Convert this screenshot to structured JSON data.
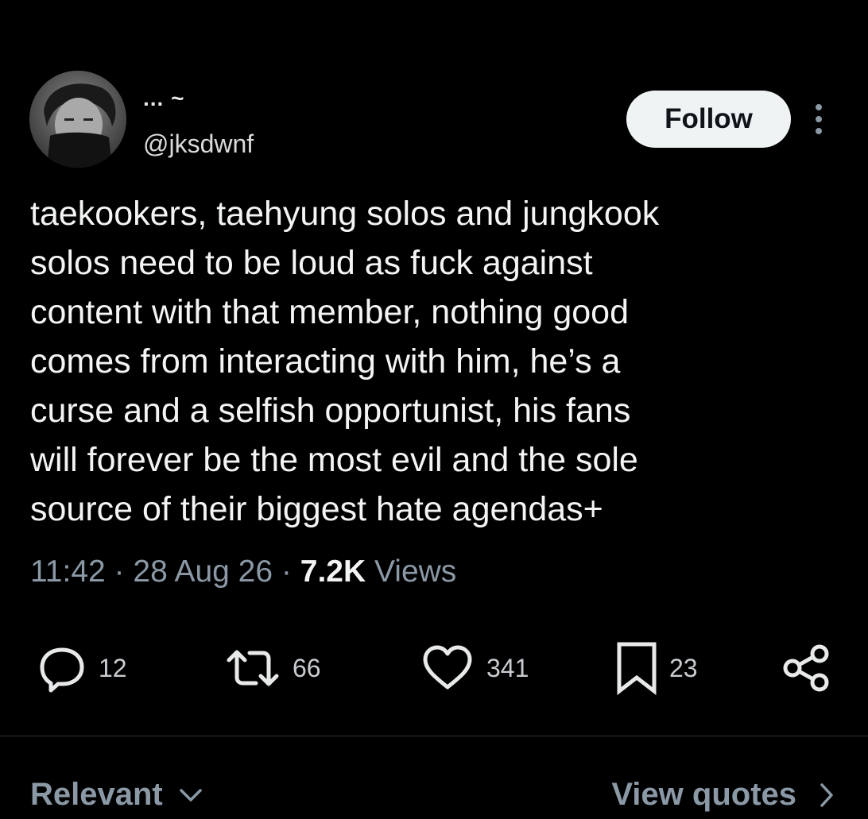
{
  "author": {
    "display_name": "... ~",
    "handle": "@jksdwnf",
    "avatar_icon": "profile-photo"
  },
  "follow_label": "Follow",
  "more_icon": "more-vertical-icon",
  "tweet": {
    "text": "taekookers, taehyung solos and jungkook\nsolos need to be loud as fuck against\ncontent with that member, nothing good\ncomes from interacting with him, he’s a\ncurse and a selfish opportunist, his fans\nwill forever be the most evil and the sole\nsource of their biggest hate agendas+"
  },
  "meta": {
    "time": "11:42",
    "separator": "·",
    "date": "28 Aug 26",
    "views_count": "7.2K",
    "views_label": "Views"
  },
  "actions": {
    "replies": "12",
    "reposts": "66",
    "likes": "341",
    "bookmarks": "23"
  },
  "footer": {
    "sort_label": "Relevant",
    "view_quotes_label": "View quotes"
  },
  "colors": {
    "background": "#000000",
    "text_primary": "#e7e9ea",
    "text_secondary": "#8b98a5",
    "follow_bg": "#eff3f4",
    "divider": "#2f3336"
  }
}
